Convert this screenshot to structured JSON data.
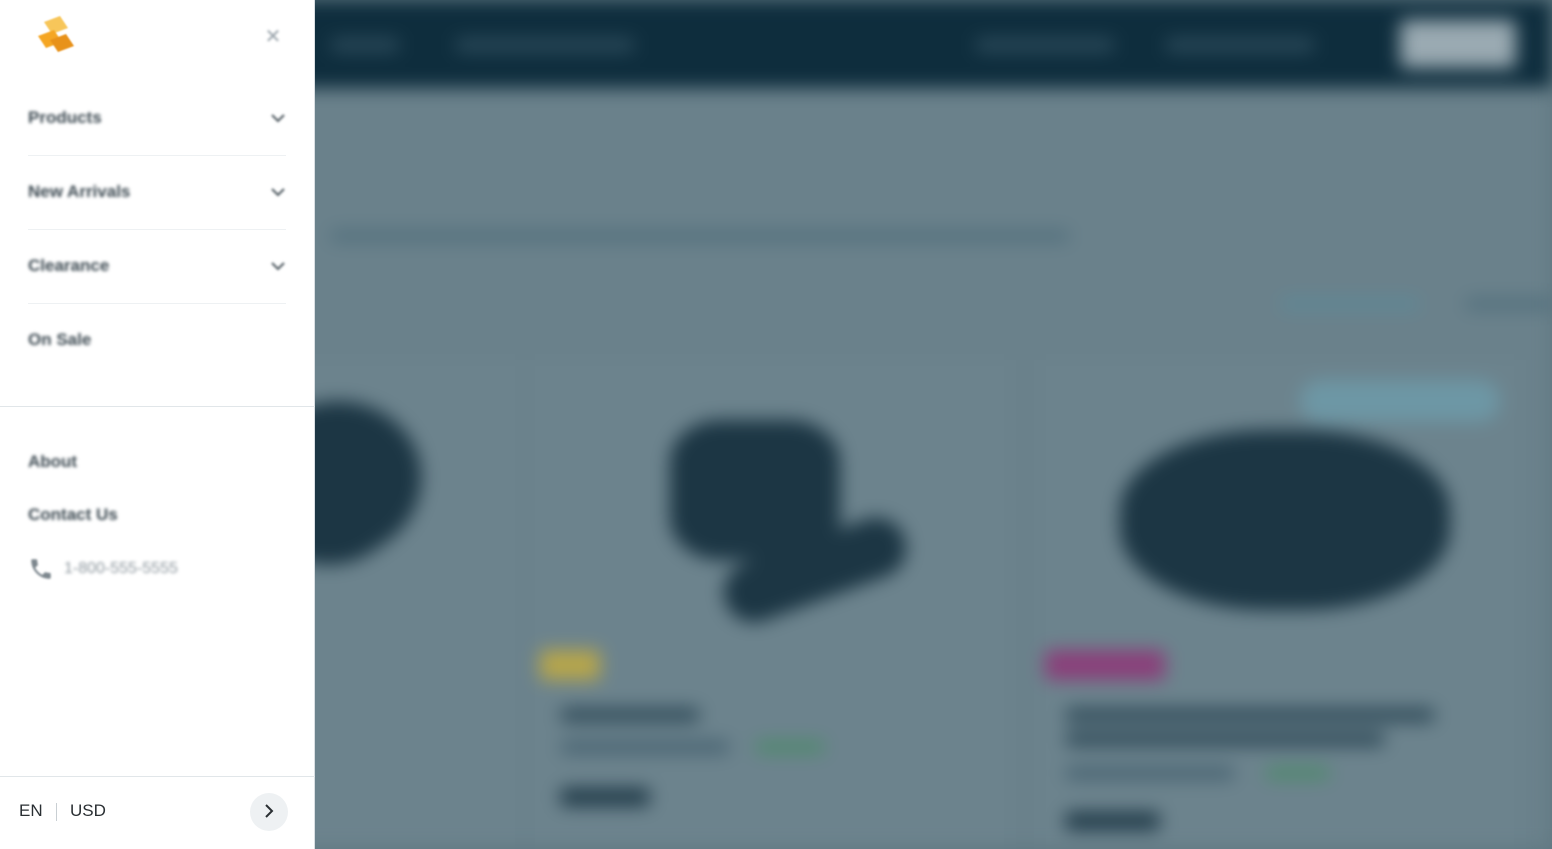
{
  "drawer": {
    "close_icon": "close-icon",
    "menu": [
      {
        "label": "Products",
        "icon": "chevron-down-icon"
      },
      {
        "label": "New Arrivals",
        "icon": "chevron-down-icon"
      },
      {
        "label": "Clearance",
        "icon": "chevron-down-icon"
      },
      {
        "label": "On Sale"
      }
    ],
    "secondary": [
      {
        "label": "About"
      },
      {
        "label": "Contact Us"
      }
    ],
    "phone": {
      "icon": "phone-icon",
      "number": "1-800-555-5555"
    },
    "footer": {
      "language": "EN",
      "currency": "USD",
      "next_icon": "chevron-right-icon"
    }
  },
  "colors": {
    "logo_primary": "#f5a623",
    "logo_secondary": "#f7c65a",
    "overlay": "#0e2d3d"
  }
}
